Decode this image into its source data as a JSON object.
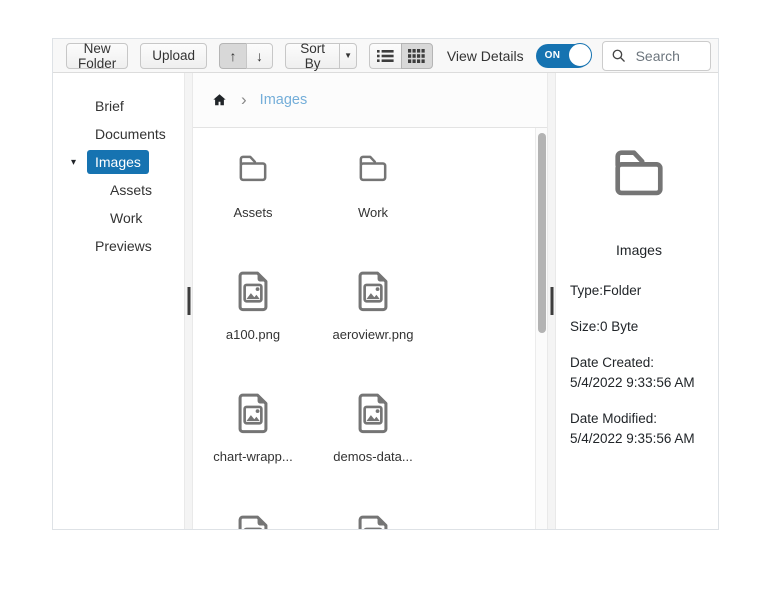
{
  "toolbar": {
    "new_folder_label": "New Folder",
    "upload_label": "Upload",
    "sort_by_label": "Sort By",
    "view_details_label": "View Details",
    "toggle": {
      "state_label": "ON",
      "on": true
    },
    "search": {
      "placeholder": "Search",
      "value": ""
    }
  },
  "glyphs": {
    "arrow_up": "↑",
    "arrow_down": "↓",
    "sort_caret": "▼",
    "tree_caret": "▾",
    "breadcrumb_separator": "›"
  },
  "sidebar": {
    "items": [
      {
        "label": "Brief",
        "level": 1,
        "selected": false,
        "expanded": false
      },
      {
        "label": "Documents",
        "level": 1,
        "selected": false,
        "expanded": false
      },
      {
        "label": "Images",
        "level": 1,
        "selected": true,
        "expanded": true
      },
      {
        "label": "Assets",
        "level": 2,
        "selected": false,
        "expanded": false
      },
      {
        "label": "Work",
        "level": 2,
        "selected": false,
        "expanded": false
      },
      {
        "label": "Previews",
        "level": 1,
        "selected": false,
        "expanded": false
      }
    ]
  },
  "breadcrumb": {
    "root": "home",
    "current": "Images"
  },
  "files": {
    "view": "large-icons",
    "items": [
      {
        "name": "Assets",
        "type": "folder",
        "partial": false
      },
      {
        "name": "Work",
        "type": "folder",
        "partial": false
      },
      {
        "name": "a100.png",
        "type": "image",
        "partial": false
      },
      {
        "name": "aeroviewr.png",
        "type": "image",
        "partial": false
      },
      {
        "name": "chart-wrapp...",
        "type": "image",
        "partial": false
      },
      {
        "name": "demos-data...",
        "type": "image",
        "partial": false
      },
      {
        "name": "",
        "type": "image",
        "partial": true
      },
      {
        "name": "",
        "type": "image",
        "partial": true
      }
    ]
  },
  "details": {
    "name": "Images",
    "type_line": "Type:Folder",
    "size_line": "Size:0 Byte",
    "created_label": "Date Created:",
    "created_value": "5/4/2022 9:33:56 AM",
    "modified_label": "Date Modified:",
    "modified_value": "5/4/2022 9:35:56 AM"
  },
  "colors": {
    "primary": "#1673b1",
    "icon_grey": "#757575",
    "breadcrumb_active": "#74aed9",
    "toolbar_bg": "#f8f8f8",
    "pressed_button_bg": "#d8d8d8"
  }
}
